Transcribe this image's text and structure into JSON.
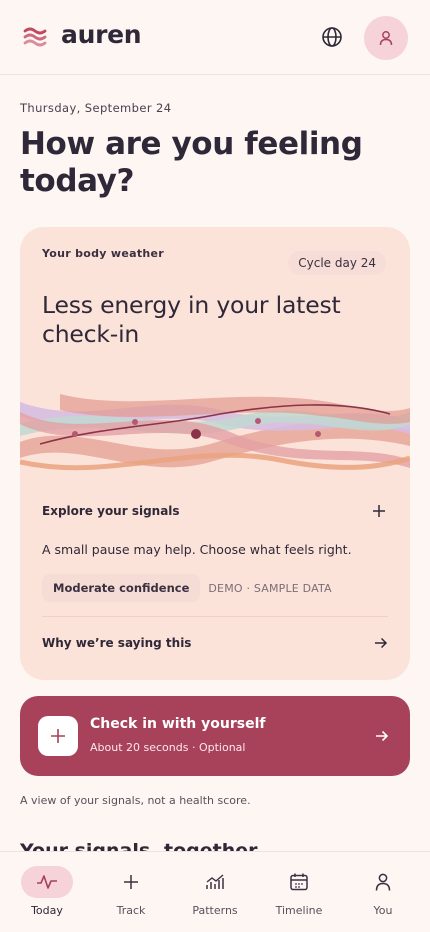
{
  "app": {
    "brand": "auren"
  },
  "header": {
    "icons": [
      "waves-logo-icon",
      "globe-icon",
      "user-icon"
    ]
  },
  "greeting": {
    "date": "Thursday, September 24",
    "title": "How are you feeling today?"
  },
  "weather_card": {
    "label": "Your body weather",
    "cycle_day": "Cycle day 24",
    "heading": "Less energy in your latest check-in",
    "explore_label": "Explore your signals",
    "pause_text": "A small pause may help. Choose what feels right.",
    "confidence": "Moderate confidence",
    "demo_label": "DEMO · SAMPLE DATA",
    "why_label": "Why we’re saying this"
  },
  "checkin": {
    "title": "Check in with yourself",
    "subtitle": "About 20 seconds · Optional"
  },
  "footnote": "A view of your signals, not a health score.",
  "signals_heading": "Your signals, together",
  "tabbar": {
    "items": [
      {
        "label": "Today",
        "icon": "pulse-icon",
        "active": true
      },
      {
        "label": "Track",
        "icon": "plus-icon",
        "active": false
      },
      {
        "label": "Patterns",
        "icon": "trend-chart-icon",
        "active": false
      },
      {
        "label": "Timeline",
        "icon": "calendar-icon",
        "active": false
      },
      {
        "label": "You",
        "icon": "user-icon",
        "active": false
      }
    ]
  },
  "colors": {
    "background": "#fdf6f3",
    "card": "#fce3d9",
    "accent": "#a8415a",
    "active_pill": "#f6d3d8",
    "text": "#2f2838"
  }
}
